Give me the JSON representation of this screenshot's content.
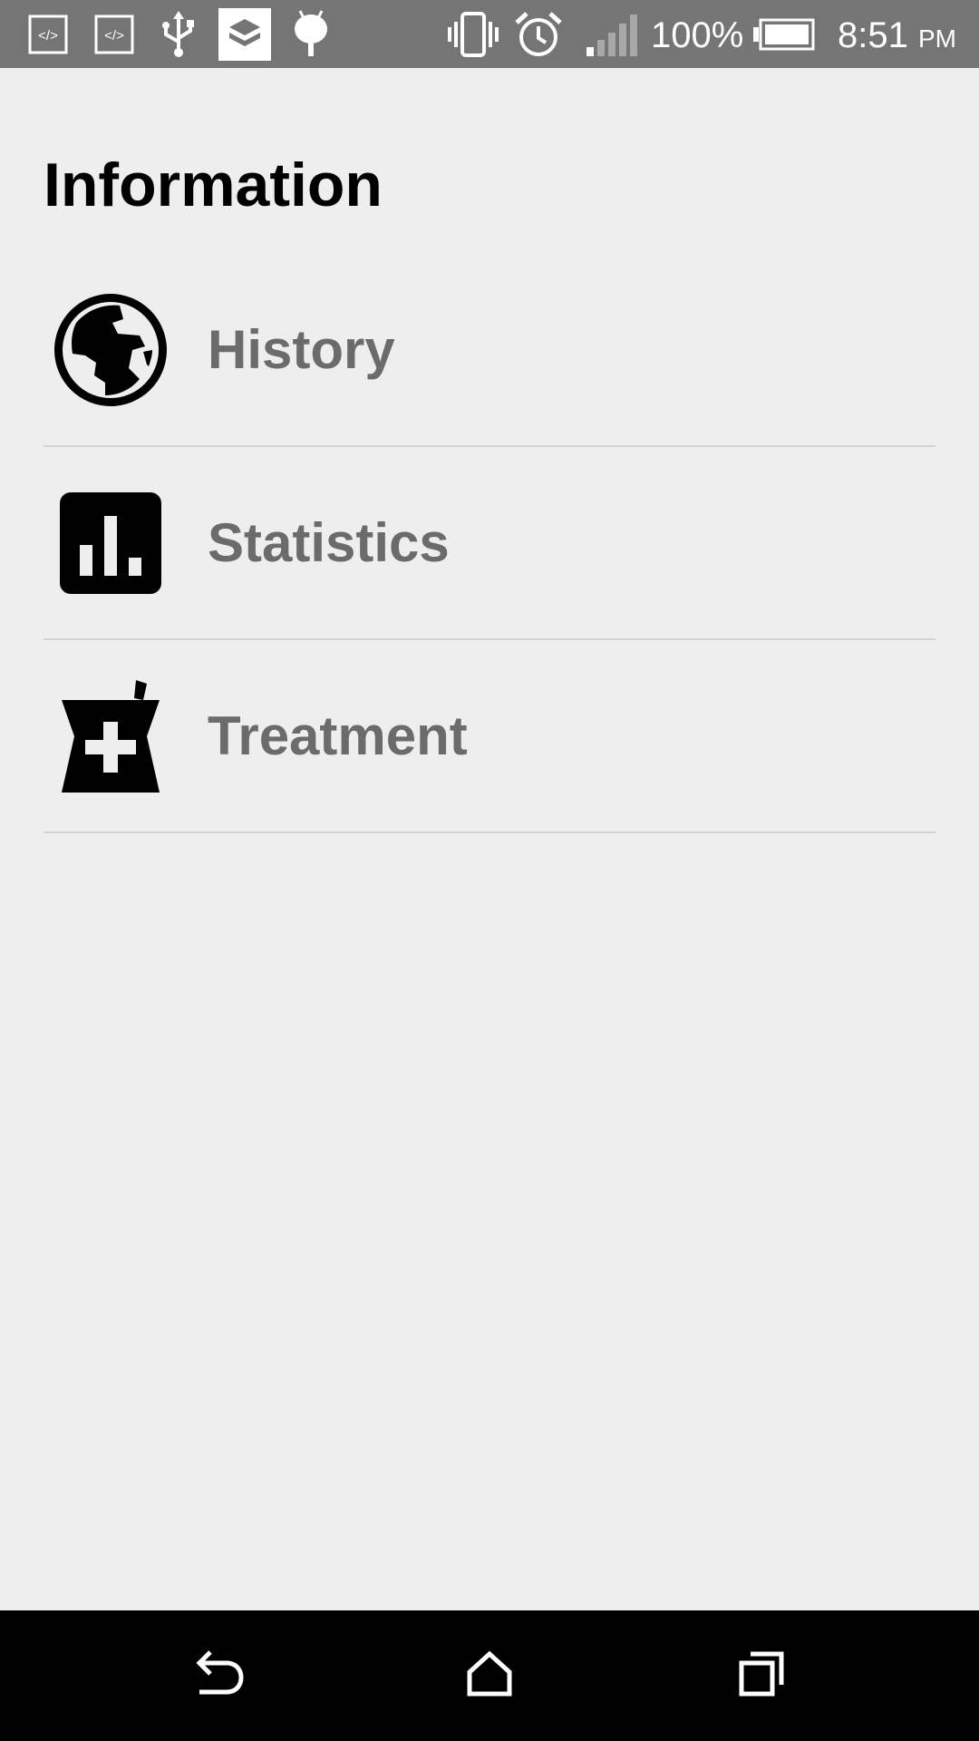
{
  "status_bar": {
    "battery": "100%",
    "time": "8:51",
    "time_suffix": "PM",
    "icons": [
      "code-icon",
      "code-icon",
      "usb-icon",
      "app-icon",
      "android-icon",
      "vibrate-icon",
      "alarm-icon",
      "signal-icon",
      "battery-icon"
    ]
  },
  "page": {
    "title": "Information"
  },
  "menu": {
    "items": [
      {
        "label": "History",
        "icon": "globe-icon"
      },
      {
        "label": "Statistics",
        "icon": "bar-chart-icon"
      },
      {
        "label": "Treatment",
        "icon": "pharmacy-icon"
      }
    ]
  },
  "nav_bar": {
    "buttons": [
      "back-icon",
      "home-icon",
      "recents-icon"
    ]
  },
  "colors": {
    "status_bar_bg": "#757575",
    "background": "#eeeeee",
    "title_text": "#000000",
    "item_text": "#6b6b6b",
    "divider": "#d2d2d2",
    "nav_bar_bg": "#000000"
  }
}
